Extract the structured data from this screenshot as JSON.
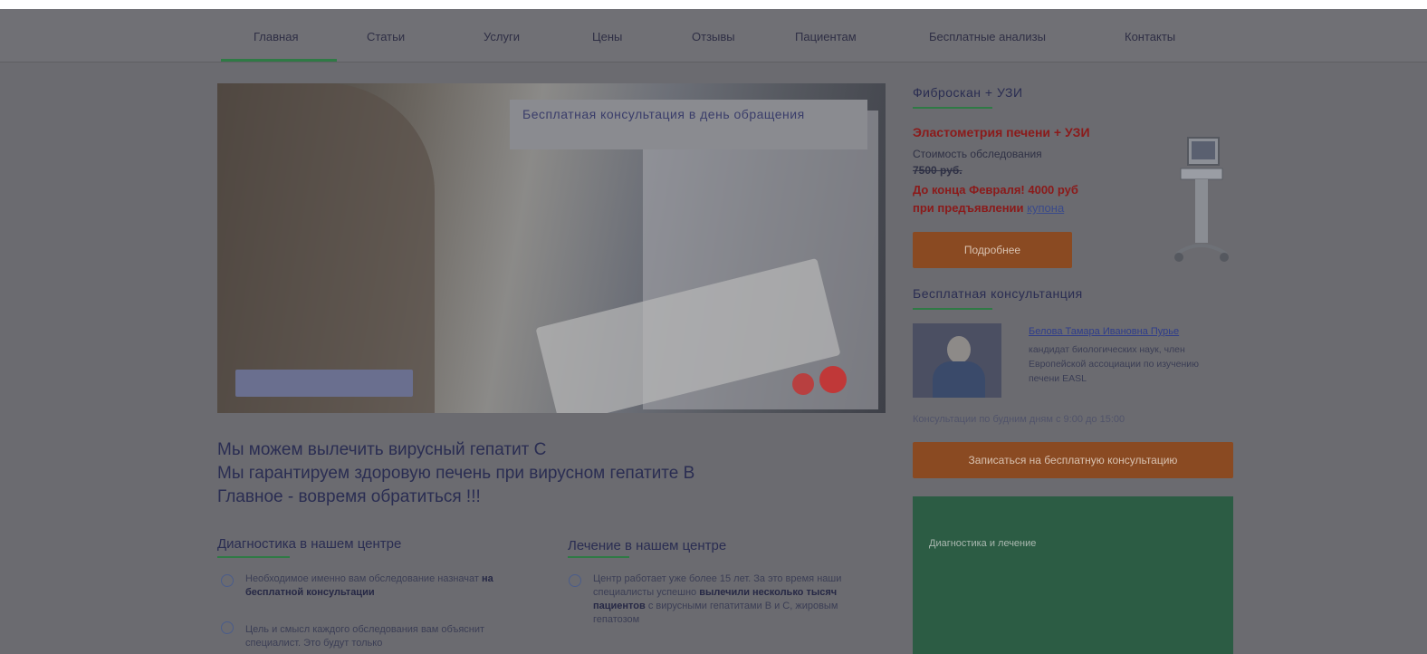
{
  "nav": {
    "items": [
      {
        "label": "Главная"
      },
      {
        "label": "Статьи"
      },
      {
        "label": "Услуги"
      },
      {
        "label": "Цены"
      },
      {
        "label": "Отзывы"
      },
      {
        "label": "Пациентам"
      },
      {
        "label": "Бесплатные анализы"
      },
      {
        "label": "Контакты"
      }
    ],
    "active_index": 0
  },
  "hero": {
    "banner_text": "Бесплатная консультация в день обращения"
  },
  "main": {
    "lines": [
      "Мы можем вылечить вирусный гепатит С",
      "Мы гарантируем здоровую печень при вирусном гепатите В",
      "Главное - вовремя обратиться !!!"
    ]
  },
  "diagnostics": {
    "title": "Диагностика в нашем центре",
    "items": [
      {
        "text": "Необходимое именно вам обследование назначат",
        "bold": "на бесплатной консультации"
      },
      {
        "text": "Цель и смысл каждого обследования вам объяснит специалист. Это будут только",
        "bold": ""
      }
    ]
  },
  "treatment": {
    "title": "Лечение в нашем центре",
    "items": [
      {
        "text": "Центр работает уже более 15 лет. За это время наши специалисты успешно",
        "bold": "вылечили несколько тысяч пациентов",
        "tail": "с вирусными гепатитами В и С, жировым гепатозом"
      }
    ]
  },
  "sidebar": {
    "fibroscan_title": "Фиброскан + УЗИ",
    "promo": {
      "title": "Эластометрия печени + УЗИ",
      "cost_label": "Стоимость обследования",
      "old_price": "7500 руб.",
      "offer_line1": "До конца Февраля! 4000 руб",
      "offer_line2": "при предъявлении",
      "offer_link": "купона",
      "button": "Подробнее"
    },
    "consult_title": "Бесплатная консультанция",
    "doctor": {
      "name": "Белова Тамара Ивановна Пурье",
      "desc": "кандидат биологических наук, член Европейской ассоциации по изучению печени EASL"
    },
    "hours": "Консультации по будним дням с 9:00 до 15:00",
    "signup_button": "Записаться на бесплатную консультацию",
    "green_box_text": "Диагностика и лечение"
  },
  "colors": {
    "accent_green": "#2f7a45",
    "promo_red": "#8b1a1a",
    "button_orange": "#8a4a22"
  }
}
